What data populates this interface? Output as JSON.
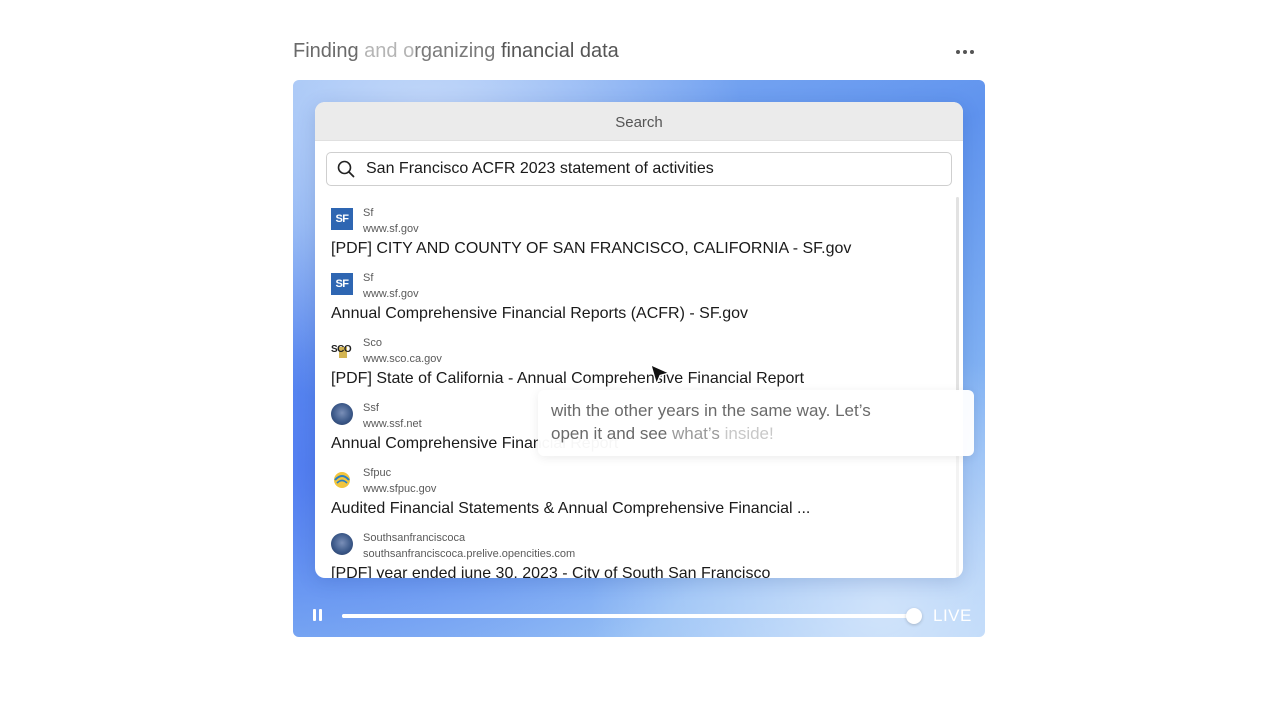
{
  "header": {
    "title_parts": [
      "Finding ",
      "and o",
      "rganizing ",
      "financial data"
    ],
    "more_icon": "more-horizontal-icon"
  },
  "search_window": {
    "title": "Search",
    "search_icon": "search-icon",
    "query": "San Francisco ACFR 2023 statement of activities",
    "results": [
      {
        "favicon": "SF",
        "site": "Sf",
        "url": "www.sf.gov",
        "title": "[PDF] CITY AND COUNTY OF SAN FRANCISCO, CALIFORNIA - SF.gov"
      },
      {
        "favicon": "SF",
        "site": "Sf",
        "url": "www.sf.gov",
        "title": "Annual Comprehensive Financial Reports (ACFR) - SF.gov"
      },
      {
        "favicon": "SCO",
        "site": "Sco",
        "url": "www.sco.ca.gov",
        "title": "[PDF] State of California - Annual Comprehensive Financial Report"
      },
      {
        "favicon": "seal",
        "site": "Ssf",
        "url": "www.ssf.net",
        "title": "Annual Comprehensive Financial Report"
      },
      {
        "favicon": "sfpuc",
        "site": "Sfpuc",
        "url": "www.sfpuc.gov",
        "title": "Audited Financial Statements & Annual Comprehensive Financial ..."
      },
      {
        "favicon": "seal",
        "site": "Southsanfranciscoca",
        "url": "southsanfranciscoca.prelive.opencities.com",
        "title": "[PDF] year ended june 30, 2023 - City of South San Francisco"
      }
    ]
  },
  "caption": {
    "line1": "with the other years in the same way. Let’s",
    "line2_a": "open it and see ",
    "line2_b": "what’s ",
    "line2_c": "inside!"
  },
  "player": {
    "pause_icon": "pause-icon",
    "progress": 0.995,
    "live_label": "LIVE"
  },
  "colors": {
    "sf_blue": "#2e66b2",
    "stage_blue": "#5f93ee"
  }
}
